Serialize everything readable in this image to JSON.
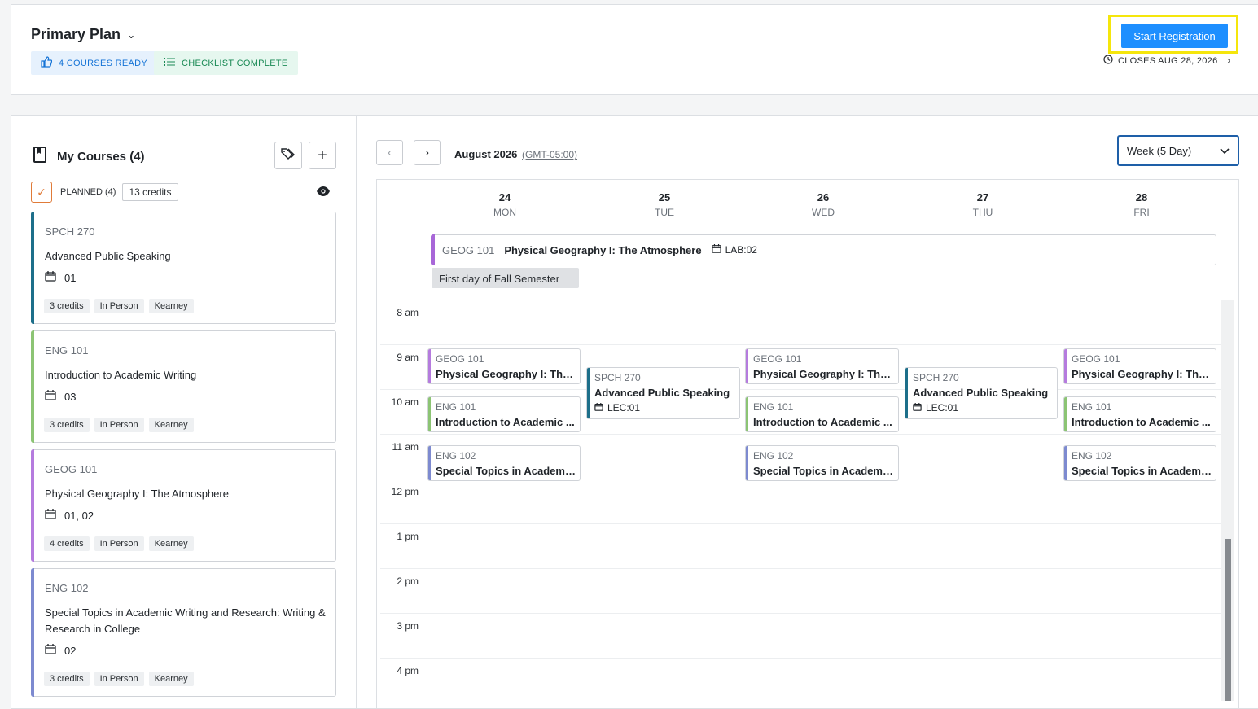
{
  "header": {
    "plan_title": "Primary Plan",
    "courses_ready": "4 COURSES READY",
    "checklist": "CHECKLIST COMPLETE",
    "start_registration": "Start Registration",
    "closes": "CLOSES AUG 28, 2026"
  },
  "sidebar": {
    "my_courses": "My Courses (4)",
    "planned": "PLANNED (4)",
    "credits": "13 credits",
    "courses": [
      {
        "code": "SPCH 270",
        "title": "Advanced Public Speaking",
        "sections": "01",
        "credits": "3 credits",
        "mode": "In Person",
        "campus": "Kearney",
        "color": "#1d6f8a"
      },
      {
        "code": "ENG 101",
        "title": "Introduction to Academic Writing",
        "sections": "03",
        "credits": "3 credits",
        "mode": "In Person",
        "campus": "Kearney",
        "color": "#8cc474"
      },
      {
        "code": "GEOG 101",
        "title": "Physical Geography I: The Atmosphere",
        "sections": "01, 02",
        "credits": "4 credits",
        "mode": "In Person",
        "campus": "Kearney",
        "color": "#b57bde"
      },
      {
        "code": "ENG 102",
        "title": "Special Topics in Academic Writing and Research: Writing & Research in College",
        "sections": "02",
        "credits": "3 credits",
        "mode": "In Person",
        "campus": "Kearney",
        "color": "#7d8ad0"
      }
    ]
  },
  "calendar": {
    "month": "August 2026",
    "timezone": "(GMT-05:00)",
    "view": "Week (5 Day)",
    "days": [
      {
        "num": "24",
        "name": "MON"
      },
      {
        "num": "25",
        "name": "TUE"
      },
      {
        "num": "26",
        "name": "WED"
      },
      {
        "num": "27",
        "name": "THU"
      },
      {
        "num": "28",
        "name": "FRI"
      }
    ],
    "allday_event": {
      "code": "GEOG 101",
      "title": "Physical Geography I: The Atmosphere",
      "section": "LAB:02"
    },
    "first_day": "First day of Fall Semester",
    "hours": [
      "8 am",
      "9 am",
      "10 am",
      "11 am",
      "12 pm",
      "1 pm",
      "2 pm",
      "3 pm",
      "4 pm"
    ],
    "events": {
      "geog": {
        "code": "GEOG 101",
        "title": "Physical Geography I: The..."
      },
      "eng101": {
        "code": "ENG 101",
        "title": "Introduction to Academic ..."
      },
      "eng102": {
        "code": "ENG 102",
        "title": "Special Topics in Academi..."
      },
      "spch": {
        "code": "SPCH 270",
        "title": "Advanced Public Speaking",
        "section": "LEC:01"
      }
    }
  }
}
